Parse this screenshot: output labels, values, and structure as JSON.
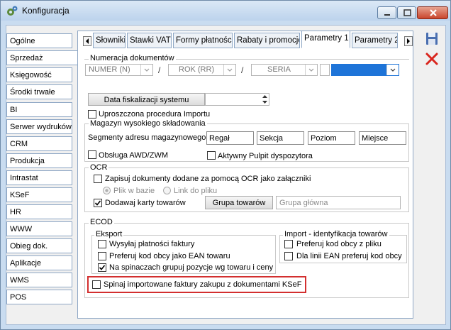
{
  "window": {
    "title": "Konfiguracja"
  },
  "sidebar": {
    "items": [
      {
        "label": "Ogólne"
      },
      {
        "label": "Sprzedaż"
      },
      {
        "label": "Księgowość"
      },
      {
        "label": "Środki trwałe"
      },
      {
        "label": "BI"
      },
      {
        "label": "Serwer wydruków"
      },
      {
        "label": "CRM"
      },
      {
        "label": "Produkcja"
      },
      {
        "label": "Intrastat"
      },
      {
        "label": "KSeF"
      },
      {
        "label": "HR"
      },
      {
        "label": "WWW"
      },
      {
        "label": "Obieg dok."
      },
      {
        "label": "Aplikacje"
      },
      {
        "label": "WMS"
      },
      {
        "label": "POS"
      }
    ],
    "active_index": 1
  },
  "tabs": [
    {
      "label": "Słowniki"
    },
    {
      "label": "Stawki VAT"
    },
    {
      "label": "Formy płatności"
    },
    {
      "label": "Rabaty i promocje"
    },
    {
      "label": "Parametry 1"
    },
    {
      "label": "Parametry 2"
    }
  ],
  "numeracja": {
    "title": "Numeracja dokumentów",
    "field1": "NUMER (N)",
    "field2": "ROK (RR)",
    "field3": "SERIA",
    "separator": "/"
  },
  "fiskalizacja": {
    "button": "Data fiskalizacji systemu"
  },
  "import": {
    "label": "Uproszczona procedura Importu"
  },
  "magazyn": {
    "title": "Magazyn wysokiego składowania",
    "segments_label": "Segmenty adresu magazynowego:",
    "segments": [
      "Regał",
      "Sekcja",
      "Poziom",
      "Miejsce"
    ],
    "awd": "Obsługa AWD/ZWM",
    "pulpit": "Aktywny Pulpit dyspozytora"
  },
  "ocr": {
    "title": "OCR",
    "zapisuj": "Zapisuj dokumenty dodane za pomocą OCR jako załączniki",
    "plik": "Plik w bazie",
    "link": "Link do pliku",
    "dodawaj": "Dodawaj karty towarów",
    "grupa_button": "Grupa towarów",
    "grupa_value": "Grupa główna"
  },
  "ecod": {
    "title": "ECOD",
    "eksport_title": "Eksport",
    "wysylaj": "Wysyłaj płatności faktury",
    "preferuj_ean": "Preferuj kod obcy jako EAN towaru",
    "spinacze": "Na spinaczach grupuj pozycje wg towaru i ceny",
    "import_title": "Import - identyfikacja towarów",
    "preferuj_plik": "Preferuj kod obcy z pliku",
    "linii": "Dla linii EAN preferuj kod obcy",
    "spinaj": "Spinaj importowane faktury zakupu z dokumentami KSeF"
  },
  "icons": {
    "save": "save-icon",
    "cancel": "cancel-icon"
  }
}
